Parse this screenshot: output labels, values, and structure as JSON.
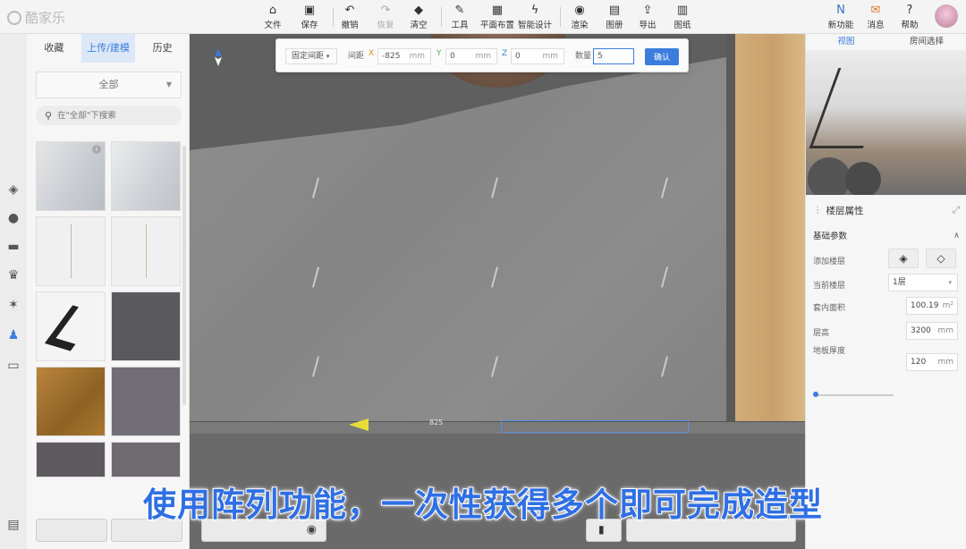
{
  "app": {
    "logo": "酷家乐"
  },
  "toolbar": {
    "items": [
      {
        "label": "文件",
        "icon": "home-icon"
      },
      {
        "label": "保存",
        "icon": "save-icon"
      },
      {
        "label": "撤销",
        "icon": "undo-icon"
      },
      {
        "label": "恢复",
        "icon": "redo-icon"
      },
      {
        "label": "清空",
        "icon": "eraser-icon"
      },
      {
        "label": "工具",
        "icon": "wrench-icon"
      },
      {
        "label": "平面布置",
        "icon": "floorplan-icon"
      },
      {
        "label": "智能设计",
        "icon": "lightning-icon"
      },
      {
        "label": "渲染",
        "icon": "render-icon"
      },
      {
        "label": "图册",
        "icon": "album-icon"
      },
      {
        "label": "导出",
        "icon": "export-icon"
      },
      {
        "label": "图纸",
        "icon": "drawing-icon"
      }
    ],
    "right": [
      {
        "label": "新功能",
        "icon": "new-feature-icon"
      },
      {
        "label": "消息",
        "icon": "gift-icon"
      },
      {
        "label": "帮助",
        "icon": "help-icon"
      }
    ]
  },
  "left_panel": {
    "tabs": [
      "收藏",
      "上传/建模",
      "历史"
    ],
    "active_tab": 1,
    "category": "全部",
    "search_placeholder": "在\"全部\"下搜索"
  },
  "array_tool": {
    "mode": "固定间距",
    "spacing_label": "间距",
    "x_label": "X",
    "x_value": "-825",
    "x_unit": "mm",
    "y_label": "Y",
    "y_value": "0",
    "y_unit": "mm",
    "z_label": "Z",
    "z_value": "0",
    "z_unit": "mm",
    "count_label": "数量",
    "count_value": "5",
    "confirm": "确认"
  },
  "viewport": {
    "dimension_label": "825"
  },
  "right_panel": {
    "view_tabs": [
      "视图",
      "房间选择"
    ],
    "props_title": "楼层属性",
    "section": "基础参数",
    "rows": {
      "add_floor": "添加楼层",
      "current_floor": "当前楼层",
      "current_floor_value": "1层",
      "area": "套内面积",
      "area_value": "100.19",
      "area_unit": "m²",
      "height": "层高",
      "height_value": "3200",
      "height_unit": "mm",
      "slab": "地板厚度",
      "slab_value": "120",
      "slab_unit": "mm"
    }
  },
  "subtitle": "使用阵列功能，一次性获得多个即可完成造型",
  "colors": {
    "accent": "#3b7ddd",
    "subtitle": "#2f6fe4"
  }
}
